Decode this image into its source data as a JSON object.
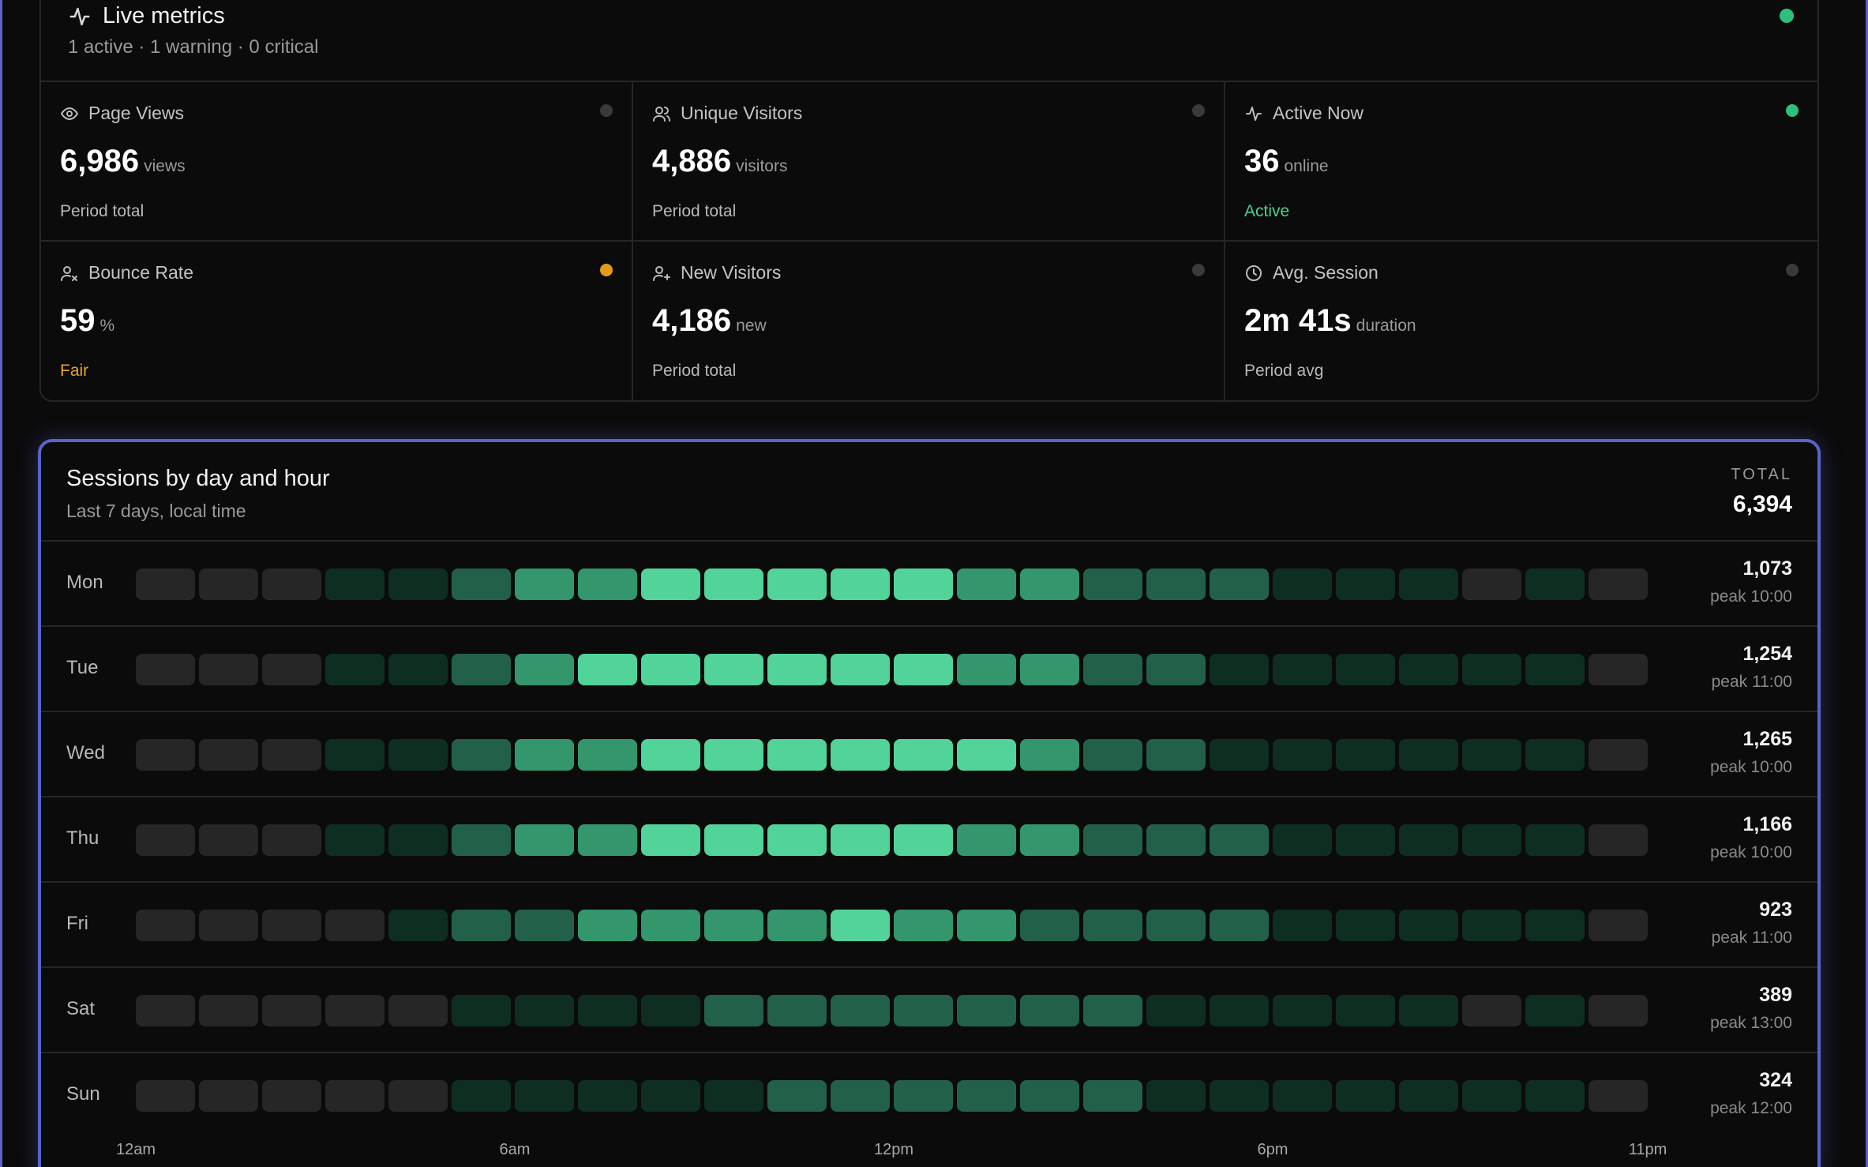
{
  "metrics": {
    "title": "Live metrics",
    "summary": "1 active · 1 warning · 0 critical",
    "status_color": "#2fbf7d",
    "cards": [
      {
        "id": "page-views",
        "label": "Page Views",
        "icon": "eye-icon",
        "value": "6,986",
        "unit": "views",
        "status": "Period total",
        "status_color": "#b8b8b8",
        "dot_color": "#3a3a3a"
      },
      {
        "id": "unique-visitors",
        "label": "Unique Visitors",
        "icon": "users-icon",
        "value": "4,886",
        "unit": "visitors",
        "status": "Period total",
        "status_color": "#b8b8b8",
        "dot_color": "#3a3a3a"
      },
      {
        "id": "active-now",
        "label": "Active Now",
        "icon": "activity-icon",
        "value": "36",
        "unit": "online",
        "status": "Active",
        "status_color": "#4ccf90",
        "dot_color": "#2fbf7d"
      },
      {
        "id": "bounce-rate",
        "label": "Bounce Rate",
        "icon": "user-x-icon",
        "value": "59",
        "unit": "%",
        "status": "Fair",
        "status_color": "#e7a623",
        "dot_color": "#e79a18"
      },
      {
        "id": "new-visitors",
        "label": "New Visitors",
        "icon": "user-plus-icon",
        "value": "4,186",
        "unit": "new",
        "status": "Period total",
        "status_color": "#b8b8b8",
        "dot_color": "#3a3a3a"
      },
      {
        "id": "avg-session",
        "label": "Avg. Session",
        "icon": "clock-icon",
        "value": "2m 41s",
        "unit": "duration",
        "status": "Period avg",
        "status_color": "#b8b8b8",
        "dot_color": "#3a3a3a"
      }
    ]
  },
  "heatmap": {
    "title": "Sessions by day and hour",
    "subtitle": "Last 7 days, local time",
    "total_label": "TOTAL",
    "total": "6,394",
    "level_colors": [
      "#262626",
      "#0f2e22",
      "#22604a",
      "#33966c",
      "#52d39a"
    ],
    "rows": [
      {
        "day": "Mon",
        "total": "1,073",
        "peak": "peak 10:00",
        "levels": [
          0,
          0,
          0,
          1,
          1,
          2,
          3,
          3,
          4,
          4,
          4,
          4,
          4,
          3,
          3,
          2,
          2,
          2,
          1,
          1,
          1,
          0,
          1,
          0
        ]
      },
      {
        "day": "Tue",
        "total": "1,254",
        "peak": "peak 11:00",
        "levels": [
          0,
          0,
          0,
          1,
          1,
          2,
          3,
          4,
          4,
          4,
          4,
          4,
          4,
          3,
          3,
          2,
          2,
          1,
          1,
          1,
          1,
          1,
          1,
          0
        ]
      },
      {
        "day": "Wed",
        "total": "1,265",
        "peak": "peak 10:00",
        "levels": [
          0,
          0,
          0,
          1,
          1,
          2,
          3,
          3,
          4,
          4,
          4,
          4,
          4,
          4,
          3,
          2,
          2,
          1,
          1,
          1,
          1,
          1,
          1,
          0
        ]
      },
      {
        "day": "Thu",
        "total": "1,166",
        "peak": "peak 10:00",
        "levels": [
          0,
          0,
          0,
          1,
          1,
          2,
          3,
          3,
          4,
          4,
          4,
          4,
          4,
          3,
          3,
          2,
          2,
          2,
          1,
          1,
          1,
          1,
          1,
          0
        ]
      },
      {
        "day": "Fri",
        "total": "923",
        "peak": "peak 11:00",
        "levels": [
          0,
          0,
          0,
          0,
          1,
          2,
          2,
          3,
          3,
          3,
          3,
          4,
          3,
          3,
          2,
          2,
          2,
          2,
          1,
          1,
          1,
          1,
          1,
          0
        ]
      },
      {
        "day": "Sat",
        "total": "389",
        "peak": "peak 13:00",
        "levels": [
          0,
          0,
          0,
          0,
          0,
          1,
          1,
          1,
          1,
          2,
          2,
          2,
          2,
          2,
          2,
          2,
          1,
          1,
          1,
          1,
          1,
          0,
          1,
          0
        ]
      },
      {
        "day": "Sun",
        "total": "324",
        "peak": "peak 12:00",
        "levels": [
          0,
          0,
          0,
          0,
          0,
          1,
          1,
          1,
          1,
          1,
          2,
          2,
          2,
          2,
          2,
          2,
          1,
          1,
          1,
          1,
          1,
          1,
          1,
          0
        ]
      }
    ],
    "x_ticks": [
      {
        "label": "12am",
        "hour": 0
      },
      {
        "label": "6am",
        "hour": 6
      },
      {
        "label": "12pm",
        "hour": 12
      },
      {
        "label": "6pm",
        "hour": 18
      },
      {
        "label": "11pm",
        "hour": 23
      }
    ]
  }
}
